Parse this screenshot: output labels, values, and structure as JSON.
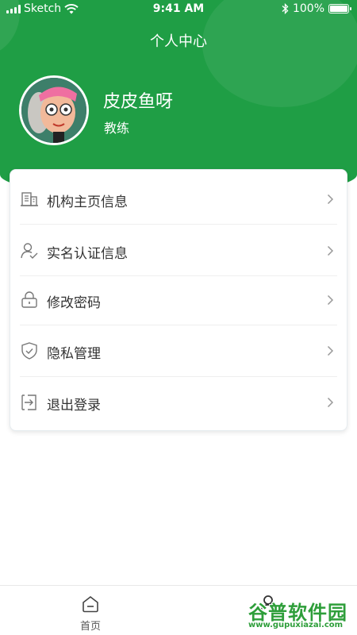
{
  "status_bar": {
    "carrier": "Sketch",
    "time": "9:41 AM",
    "battery_text": "100%",
    "battery_level": 1.0
  },
  "header": {
    "title": "个人中心",
    "background_color": "#1f9e45"
  },
  "profile": {
    "name": "皮皮鱼呀",
    "role": "教练"
  },
  "menu": {
    "items": [
      {
        "label": "机构主页信息",
        "icon": "building-icon"
      },
      {
        "label": "实名认证信息",
        "icon": "user-verified-icon"
      },
      {
        "label": "修改密码",
        "icon": "lock-icon"
      },
      {
        "label": "隐私管理",
        "icon": "shield-check-icon"
      },
      {
        "label": "退出登录",
        "icon": "logout-icon"
      }
    ]
  },
  "tab_bar": {
    "home_label": "首页",
    "mine_icon": "user-icon"
  },
  "watermark": {
    "text": "谷普软件园",
    "url": "www.gupuxiazai.com"
  }
}
